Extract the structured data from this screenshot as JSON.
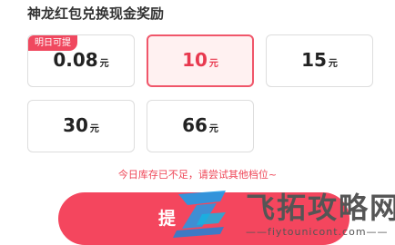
{
  "section_title": "神龙红包兑换现金奖励",
  "options": [
    {
      "value": "0.08",
      "unit": "元",
      "badge": "明日可提",
      "selected": false
    },
    {
      "value": "10",
      "unit": "元",
      "selected": true
    },
    {
      "value": "15",
      "unit": "元",
      "selected": false
    },
    {
      "value": "30",
      "unit": "元",
      "selected": false
    },
    {
      "value": "66",
      "unit": "元",
      "selected": false
    }
  ],
  "notice": "今日库存已不足，请尝试其他档位~",
  "cta_label": "提",
  "watermark": {
    "text": "飞拓攻略网",
    "url": "——fiytounicont.com——"
  },
  "colors": {
    "accent": "#f0485f",
    "selected_bg": "#fff1f1",
    "notice": "#ee4455"
  }
}
